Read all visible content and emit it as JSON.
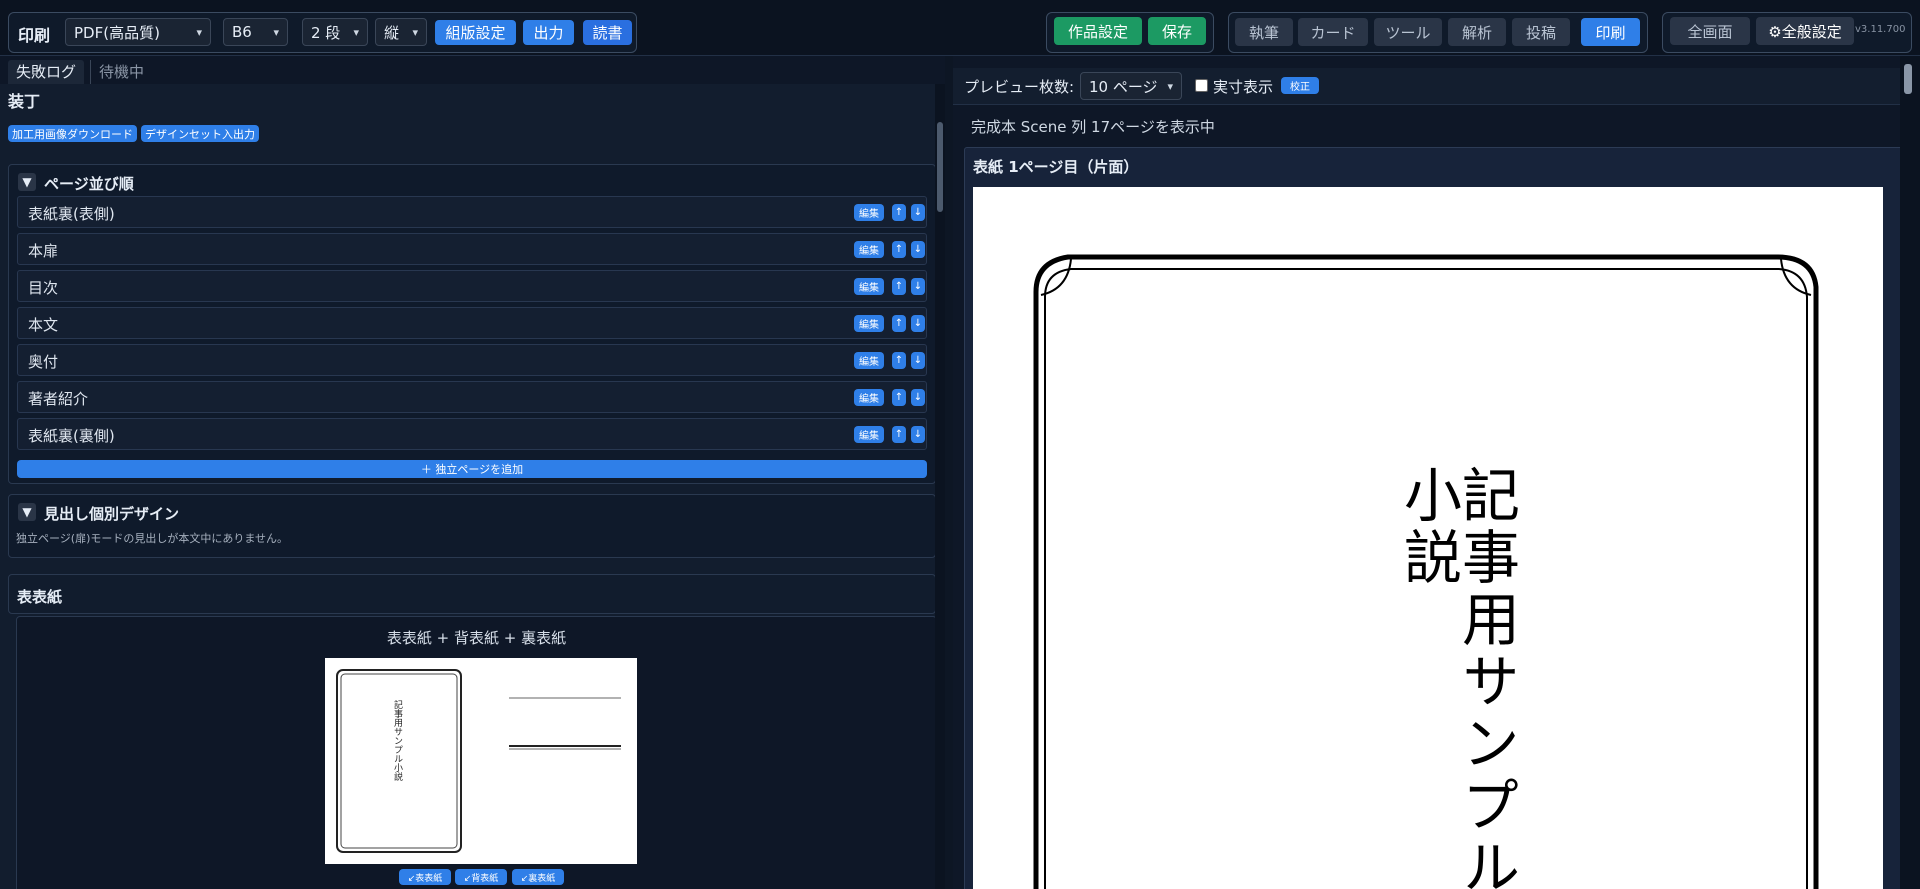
{
  "toolbar": {
    "print_label": "印刷",
    "format": "PDF(高品質)",
    "size": "B6",
    "columns": "2 段",
    "orientation": "縦",
    "layout_btn": "組版設定",
    "output_btn": "出力",
    "read_btn": "読書",
    "work_settings_btn": "作品設定",
    "save_btn": "保存",
    "nav": [
      "執筆",
      "カード",
      "ツール",
      "解析",
      "投稿",
      "印刷"
    ],
    "fullscreen_btn": "全画面",
    "global_settings_btn": "⚙全般設定",
    "version": "v3.11.700"
  },
  "left": {
    "tabs": [
      "失敗ログ",
      "待機中"
    ],
    "heading": "装丁",
    "download_btn": "加工用画像ダウンロード",
    "designset_btn": "デザインセット入出力",
    "page_order": {
      "title": "ページ並び順",
      "toggle": "▼",
      "rows": [
        "表紙裏(表側)",
        "本扉",
        "目次",
        "本文",
        "奥付",
        "著者紹介",
        "表紙裏(裏側)"
      ],
      "edit_label": "編集",
      "up_label": "↑",
      "down_label": "↓",
      "add_btn": "＋ 独立ページを追加"
    },
    "heading_design": {
      "toggle": "▼",
      "title": "見出し個別デザイン",
      "note": "独立ページ(扉)モードの見出しが本文中にありません。"
    },
    "cover": {
      "title": "表表紙",
      "subtitle": "表表紙 + 背表紙 + 裏表紙",
      "thumb_text": "記事用サンプル小説",
      "buttons": [
        "↙表表紙",
        "↙背表紙",
        "↙裏表紙"
      ]
    }
  },
  "right": {
    "preview_count_label": "プレビュー枚数:",
    "preview_count_value": "10 ページ",
    "actual_size_label": "実寸表示",
    "proof_btn": "校正",
    "status": "完成本 Scene 列 17ページを表示中",
    "page_title": "表紙 1ページ目（片面）",
    "cover_title": "記事用サンプル小説"
  },
  "colors": {
    "accent_blue": "#2f7fe8",
    "accent_green": "#1c9a63",
    "background": "#0d1624"
  }
}
